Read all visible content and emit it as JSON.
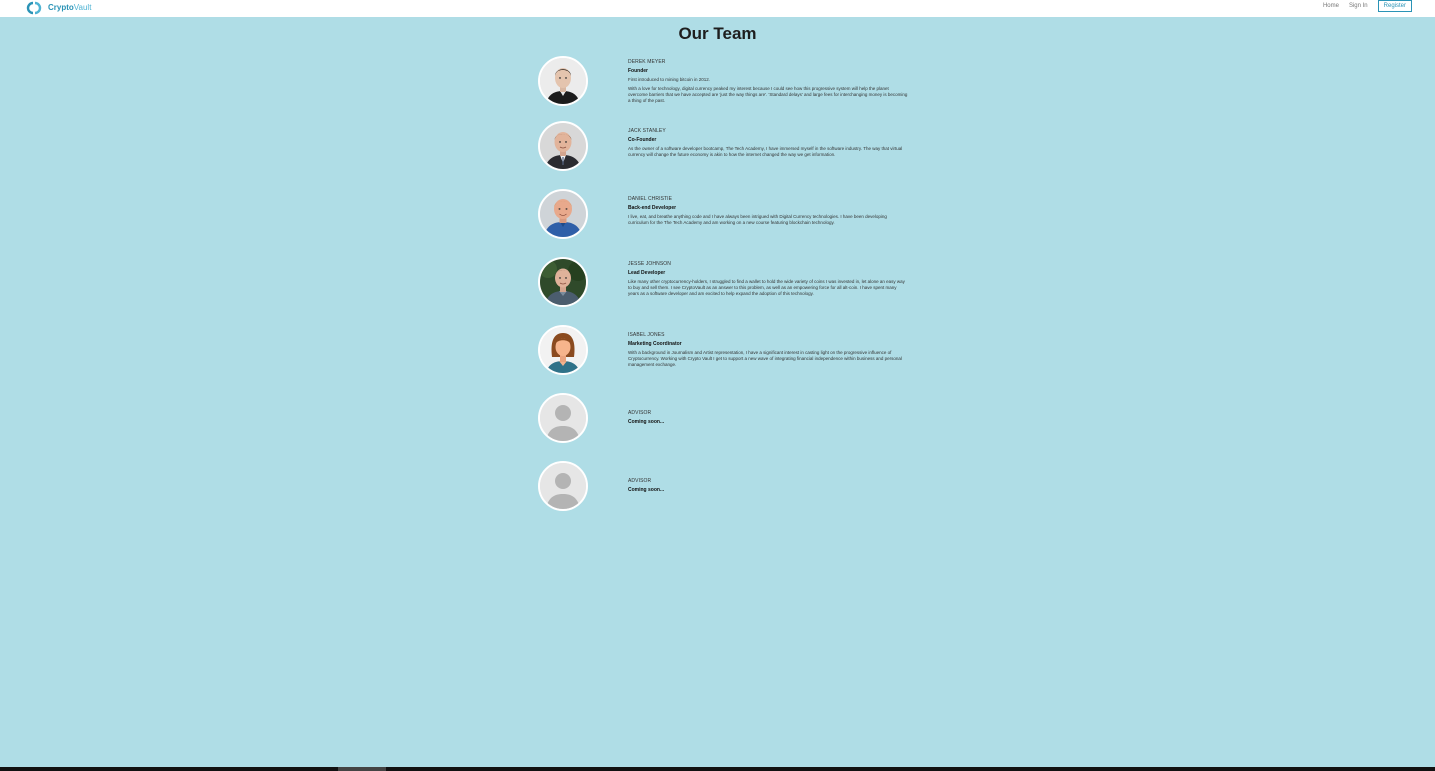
{
  "header": {
    "logo_bold": "Crypto",
    "logo_light": "Vault",
    "nav": {
      "home": "Home",
      "sign_in": "Sign In",
      "register": "Register"
    }
  },
  "page_title": "Our Team",
  "members": [
    {
      "name": "DEREK MEYER",
      "role": "Founder",
      "bio": [
        "First introduced to mining bitcoin in 2012.",
        "With a love for technology, digital currency peaked my interest because I could see how this progressive system will help the planet overcome barriers that we have accepted are 'just the way things are'. 'Standard delays' and large fees for interchanging money is becoming a thing of the past."
      ],
      "avatar": "photo-man-dark-hair"
    },
    {
      "name": "JACK STANLEY",
      "role": "Co-Founder",
      "bio": [
        "As the owner of a software developer bootcamp, The Tech Academy, I have immersed myself in the software industry. The way that virtual currency will change the future economy is akin to how the internet changed the way we get information."
      ],
      "avatar": "photo-man-suit"
    },
    {
      "name": "DANIEL CHRISTIE",
      "role": "Back-end Developer",
      "bio": [
        "I live, eat, and breathe anything code and I have always been intrigued with Digital Currency technologies. I have been developing curriculum for the The Tech Academy and am working on a new course featuring blockchain technology."
      ],
      "avatar": "photo-man-blue-shirt"
    },
    {
      "name": "JESSE JOHNSON",
      "role": "Lead Developer",
      "bio": [
        "Like many other cryptocurrency-holders, I struggled to find a wallet to hold the wide variety of coins I was invested in, let alone an easy way to buy and sell them. I see CryptoVault as an answer to this problem, as well as an empowering force for all alt-coin. I have spent many years as a software developer and am excited to help expand the adoption of this technology."
      ],
      "avatar": "photo-man-outdoor"
    },
    {
      "name": "ISABEL JONES",
      "role": "Marketing Coordinator",
      "bio": [
        "With a background in Journalism and Artist representation, I have a significant interest in casting light on the progressive influence of Cryptocurrency. Working with Crypto Vault I get to support a new wave of integrating financial independence within business and personal management exchange."
      ],
      "avatar": "illustration-woman"
    },
    {
      "name": "ADVISOR",
      "role": "Coming soon...",
      "bio": [],
      "avatar": "placeholder-person"
    },
    {
      "name": "ADVISOR",
      "role": "Coming soon...",
      "bio": [],
      "avatar": "placeholder-person"
    }
  ],
  "colors": {
    "background": "#afdde6",
    "brand": "#2a93b6",
    "header": "#ffffff"
  }
}
